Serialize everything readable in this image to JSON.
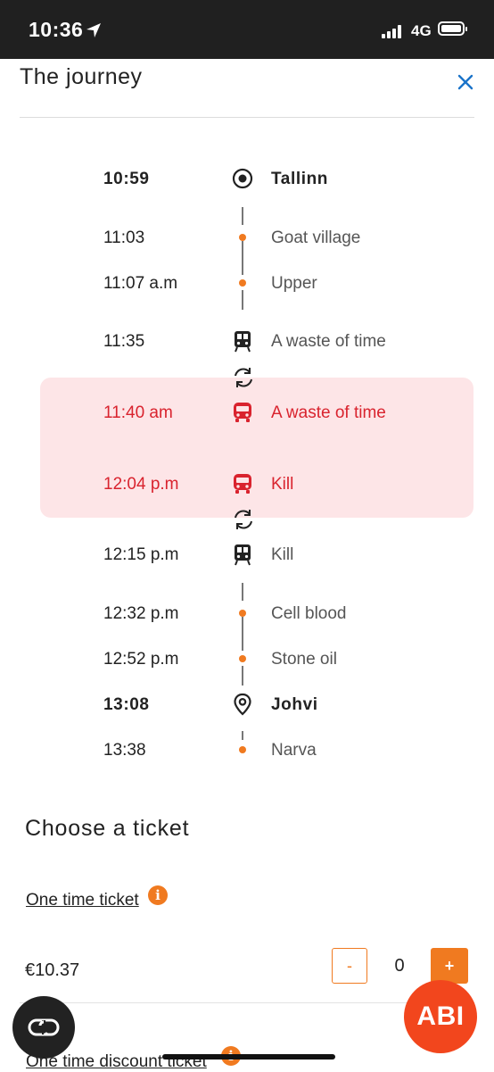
{
  "status_bar": {
    "time": "10:36",
    "network": "4G"
  },
  "header": {
    "title": "The journey"
  },
  "journey": {
    "stops": [
      {
        "time": "10:59",
        "name": "Tallinn"
      },
      {
        "time": "11:03",
        "name": "Goat village"
      },
      {
        "time": "11:07 a.m",
        "name": "Upper"
      },
      {
        "time": "11:35",
        "name": "A waste of time"
      },
      {
        "time": "11:40 am",
        "name": "A waste of time"
      },
      {
        "time": "12:04 p.m",
        "name": "Kill"
      },
      {
        "time": "12:15 p.m",
        "name": "Kill"
      },
      {
        "time": "12:32 p.m",
        "name": "Cell blood"
      },
      {
        "time": "12:52 p.m",
        "name": "Stone oil"
      },
      {
        "time": "13:08",
        "name": "Johvi"
      },
      {
        "time": "13:38",
        "name": "Narva"
      }
    ]
  },
  "tickets": {
    "title": "Choose a ticket",
    "items": [
      {
        "label": "One time ticket",
        "price": "€10.37",
        "quantity": "0",
        "minus_label": "-",
        "plus_label": "+"
      },
      {
        "label": "One time discount ticket"
      }
    ]
  },
  "abi_button": "ABI",
  "colors": {
    "accent": "#f07a20",
    "alert": "#d9232e",
    "highlight_bg": "#fde5e7",
    "status_bar": "#202020",
    "abi": "#f2461d"
  }
}
